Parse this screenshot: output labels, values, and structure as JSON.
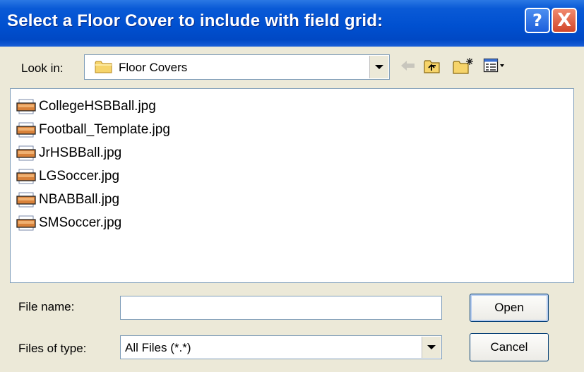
{
  "dialog": {
    "title": "Select a Floor Cover to include with field grid:"
  },
  "look_in": {
    "label": "Look in:",
    "value": "Floor Covers"
  },
  "files": [
    "CollegeHSBBall.jpg",
    "Football_Template.jpg",
    "JrHSBBall.jpg",
    "LGSoccer.jpg",
    "NBABBall.jpg",
    "SMSoccer.jpg"
  ],
  "file_name": {
    "label": "File name:",
    "value": ""
  },
  "file_type": {
    "label": "Files of type:",
    "value": "All Files (*.*)"
  },
  "buttons": {
    "open": "Open",
    "cancel": "Cancel",
    "help": "?",
    "close": "X"
  },
  "icons": {
    "folder": "folder-icon",
    "back": "back-arrow-icon",
    "up": "up-folder-icon",
    "new_folder": "new-folder-icon",
    "view_menu": "view-menu-icon",
    "file": "jpg-file-icon"
  },
  "colors": {
    "title_bar": "#0050d0",
    "dialog_bg": "#ece9d8",
    "close_button": "#d2462a"
  }
}
